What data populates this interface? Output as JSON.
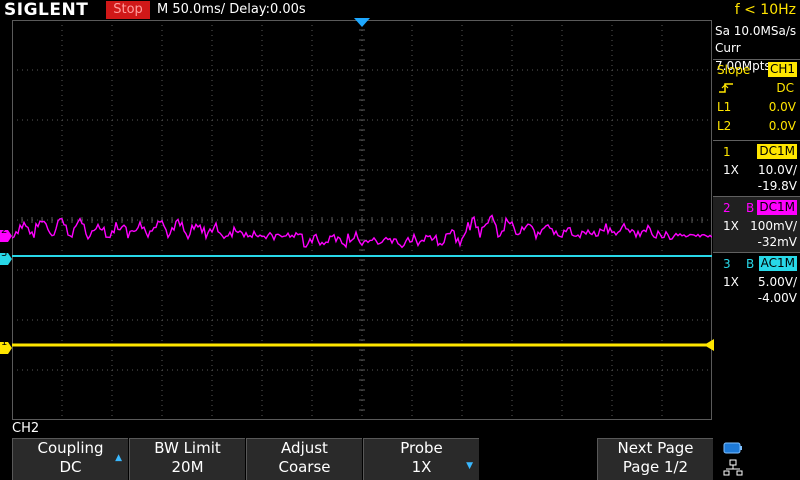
{
  "topbar": {
    "brand": "SIGLENT",
    "run_state": "Stop",
    "timebase": "M 50.0ms/ Delay:0.00s",
    "frequency": "f < 10Hz"
  },
  "acquisition": {
    "sample_rate": "Sa 10.0MSa/s",
    "memory_depth": "Curr 7.00Mpts"
  },
  "trigger_panel": {
    "type_label": "Slope",
    "source": "CH1",
    "coupling": "DC",
    "l1_label": "L1",
    "l1_value": "0.0V",
    "l2_label": "L2",
    "l2_value": "0.0V"
  },
  "channels": [
    {
      "num": "1",
      "bw_flag": "",
      "coupling": "DC1M",
      "probe": "1X",
      "scale": "10.0V/",
      "offset": "-19.8V",
      "color": "#ffe600"
    },
    {
      "num": "2",
      "bw_flag": "B",
      "coupling": "DC1M",
      "probe": "1X",
      "scale": "100mV/",
      "offset": "-32mV",
      "color": "#ff00ff"
    },
    {
      "num": "3",
      "bw_flag": "B",
      "coupling": "AC1M",
      "probe": "1X",
      "scale": "5.00V/",
      "offset": "-4.00V",
      "color": "#28d8e8"
    }
  ],
  "menu": {
    "title": "CH2",
    "softkeys": [
      {
        "line1": "Coupling",
        "line2": "DC",
        "arrow": "up"
      },
      {
        "line1": "BW Limit",
        "line2": "20M",
        "arrow": ""
      },
      {
        "line1": "Adjust",
        "line2": "Coarse",
        "arrow": ""
      },
      {
        "line1": "Probe",
        "line2": "1X",
        "arrow": "down"
      },
      {
        "line1": "",
        "line2": "",
        "arrow": ""
      },
      {
        "line1": "Next Page",
        "line2": "Page 1/2",
        "arrow": ""
      }
    ]
  },
  "markers": {
    "ch1": "1",
    "ch2": "2",
    "ch3": "3"
  },
  "colors": {
    "ch1": "#ffe600",
    "ch2": "#ff00ff",
    "ch3": "#28d8e8",
    "stop": "#d01818",
    "trigger_marker": "#1ea8ff"
  }
}
